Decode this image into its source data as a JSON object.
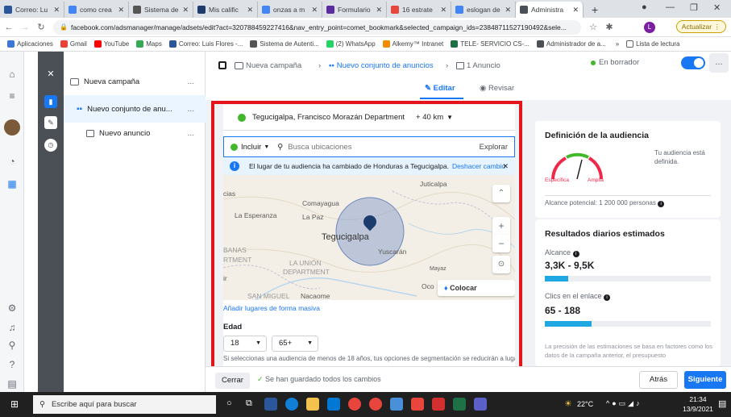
{
  "browser": {
    "tabs": [
      {
        "label": "Correo: Lu",
        "color": "#2b579a"
      },
      {
        "label": "como crea",
        "color": "#4285f4"
      },
      {
        "label": "Sistema de",
        "color": "#555555"
      },
      {
        "label": "Mis calific",
        "color": "#1d3c6e"
      },
      {
        "label": "onzas a m",
        "color": "#4285f4"
      },
      {
        "label": "Formulario",
        "color": "#5b2ca0"
      },
      {
        "label": "16 estrate",
        "color": "#e8453c"
      },
      {
        "label": "eslogan de",
        "color": "#4285f4"
      },
      {
        "label": "Administra",
        "color": "#4b4f56",
        "active": true
      }
    ],
    "url": "facebook.com/adsmanager/manage/adsets/edit?act=320788459227416&nav_entry_point=comet_bookmark&selected_campaign_ids=23848711527190492&sele...",
    "update_label": "Actualizar",
    "profile_initial": "L",
    "bookmarks": [
      {
        "label": "Aplicaciones",
        "color": "#3c78d8"
      },
      {
        "label": "Gmail",
        "color": "#ea4335"
      },
      {
        "label": "YouTube",
        "color": "#ff0000"
      },
      {
        "label": "Maps",
        "color": "#34a853"
      },
      {
        "label": "Correo: Luis Flores -...",
        "color": "#2b579a"
      },
      {
        "label": "Sistema de Autenti...",
        "color": "#555555"
      },
      {
        "label": "(2) WhatsApp",
        "color": "#25d366"
      },
      {
        "label": "Alkemy™ Intranet",
        "color": "#f28b00"
      },
      {
        "label": "TELE- SERVICIO CS-...",
        "color": "#1e7145"
      },
      {
        "label": "Administrador de a...",
        "color": "#4b4f56"
      }
    ],
    "reading_list": "Lista de lectura"
  },
  "tree": {
    "campaign": "Nueva campaña",
    "adset": "Nuevo conjunto de anu...",
    "ad": "Nuevo anuncio",
    "more": "..."
  },
  "header": {
    "crumb_campaign": "Nueva campaña",
    "crumb_adset": "Nuevo conjunto de anuncios",
    "crumb_ad": "1 Anuncio",
    "status": "En borrador",
    "edit_label": "Editar",
    "review_label": "Revisar",
    "more": "..."
  },
  "location": {
    "selected": "Tegucigalpa, Francisco Morazán Department",
    "radius": "+ 40 km",
    "include_label": "Incluir",
    "search_placeholder": "Busca ubicaciones",
    "explore_label": "Explorar",
    "info_text": "El lugar de tu audiencia ha cambiado de Honduras a Tegucigalpa.",
    "undo_label": "Deshacer cambio",
    "map_labels": {
      "juticalpa": "Juticalpa",
      "comayagua": "Comayagua",
      "la_esperanza": "La Esperanza",
      "la_paz": "La Paz",
      "tegucigalpa": "Tegucigalpa",
      "yuscaran": "Yuscarán",
      "banas": "BANAS",
      "rtment": "RTMENT",
      "la_union": "LA UNIÓN",
      "department": "DEPARTMENT",
      "san_miguel": "SAN MIGUEL",
      "nacaome": "Nacaome",
      "oco": "Oco",
      "cias": "cias",
      "ir": "ir",
      "mayaz": "Mayaz"
    },
    "place_pin_label": "Colocar marcador",
    "bulk_link": "Añadir lugares de forma masiva",
    "age_heading": "Edad",
    "age_min": "18",
    "age_max": "65+",
    "age_note": "Si seleccionas una audiencia de menos de 18 años, tus opciones de segmentación se reducirán a lugar"
  },
  "audience": {
    "title": "Definición de la audiencia",
    "gauge_left": "Específica",
    "gauge_right": "Amplia",
    "defined_text": "Tu audiencia está definida.",
    "potential": "Alcance potencial: 1 200 000 personas"
  },
  "estimates": {
    "title": "Resultados diarios estimados",
    "reach_label": "Alcance",
    "reach_value": "3,3K - 9,5K",
    "reach_fill": 0.14,
    "clicks_label": "Clics en el enlace",
    "clicks_value": "65 - 188",
    "clicks_fill": 0.28,
    "footnote": "La precisión de las estimaciones se basa en factores como los datos de la campaña anterior, el presupuesto"
  },
  "footer": {
    "close_label": "Cerrar",
    "saved_text": "Se han guardado todos los cambios",
    "back_label": "Atrás",
    "next_label": "Siguiente"
  },
  "taskbar": {
    "search_placeholder": "Escribe aquí para buscar",
    "temperature": "22°C",
    "time": "21:34",
    "date": "13/9/2021"
  },
  "colors": {
    "accent": "#1877f2",
    "highlight": "#e5141a",
    "status_green": "#42b72a"
  }
}
